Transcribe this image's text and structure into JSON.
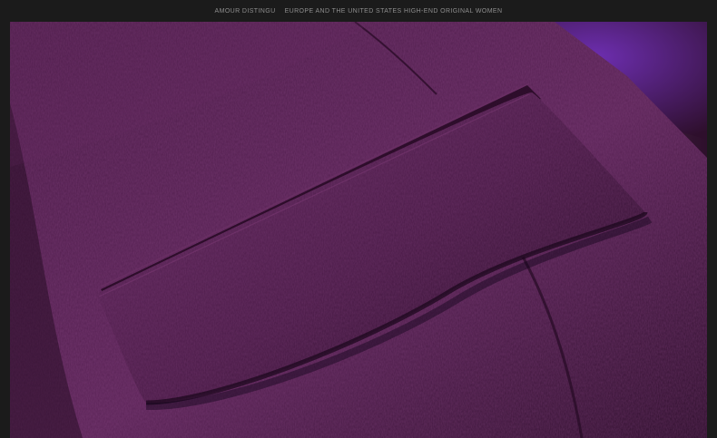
{
  "header": {
    "brand": "AMOUR DISTINGU",
    "tagline": "EUROPE AND THE UNITED STATES HIGH-END ORIGINAL WOMEN"
  },
  "photo": {
    "subject": "purple-wool-jacket-pocket-flap",
    "colors": {
      "fabric_dark": "#2e0f2c",
      "fabric_mid": "#4a1b47",
      "fabric_light": "#5b2457",
      "lining": "#6d2eb0",
      "background_left": "#cfc8cf"
    }
  }
}
